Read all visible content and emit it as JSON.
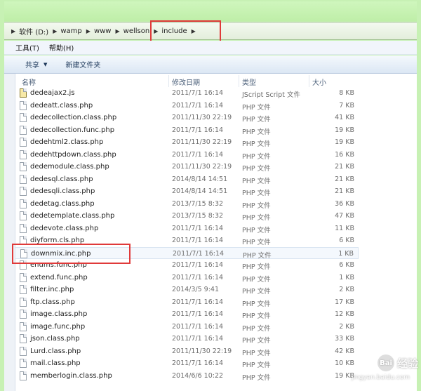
{
  "address": {
    "crumbs": [
      "软件 (D:)",
      "wamp",
      "www",
      "wellson",
      "include"
    ]
  },
  "menu": {
    "tools": "工具(T)",
    "help": "帮助(H)"
  },
  "toolbar": {
    "share": "共享",
    "new_folder": "新建文件夹"
  },
  "columns": {
    "name": "名称",
    "date": "修改日期",
    "type": "类型",
    "size": "大小"
  },
  "files": [
    {
      "name": "dedeajax2.js",
      "date": "2011/7/1 16:14",
      "type": "JScript Script 文件",
      "size": "8 KB"
    },
    {
      "name": "dedeatt.class.php",
      "date": "2011/7/1 16:14",
      "type": "PHP 文件",
      "size": "7 KB"
    },
    {
      "name": "dedecollection.class.php",
      "date": "2011/11/30 22:19",
      "type": "PHP 文件",
      "size": "41 KB"
    },
    {
      "name": "dedecollection.func.php",
      "date": "2011/7/1 16:14",
      "type": "PHP 文件",
      "size": "19 KB"
    },
    {
      "name": "dedehtml2.class.php",
      "date": "2011/11/30 22:19",
      "type": "PHP 文件",
      "size": "19 KB"
    },
    {
      "name": "dedehttpdown.class.php",
      "date": "2011/7/1 16:14",
      "type": "PHP 文件",
      "size": "16 KB"
    },
    {
      "name": "dedemodule.class.php",
      "date": "2011/11/30 22:19",
      "type": "PHP 文件",
      "size": "21 KB"
    },
    {
      "name": "dedesql.class.php",
      "date": "2014/8/14 14:51",
      "type": "PHP 文件",
      "size": "21 KB"
    },
    {
      "name": "dedesqli.class.php",
      "date": "2014/8/14 14:51",
      "type": "PHP 文件",
      "size": "21 KB"
    },
    {
      "name": "dedetag.class.php",
      "date": "2013/7/15 8:32",
      "type": "PHP 文件",
      "size": "36 KB"
    },
    {
      "name": "dedetemplate.class.php",
      "date": "2013/7/15 8:32",
      "type": "PHP 文件",
      "size": "47 KB"
    },
    {
      "name": "dedevote.class.php",
      "date": "2011/7/1 16:14",
      "type": "PHP 文件",
      "size": "11 KB"
    },
    {
      "name": "diyform.cls.php",
      "date": "2011/7/1 16:14",
      "type": "PHP 文件",
      "size": "6 KB"
    },
    {
      "name": "downmix.inc.php",
      "date": "2011/7/1 16:14",
      "type": "PHP 文件",
      "size": "1 KB"
    },
    {
      "name": "enums.func.php",
      "date": "2011/7/1 16:14",
      "type": "PHP 文件",
      "size": "6 KB"
    },
    {
      "name": "extend.func.php",
      "date": "2011/7/1 16:14",
      "type": "PHP 文件",
      "size": "1 KB"
    },
    {
      "name": "filter.inc.php",
      "date": "2014/3/5 9:41",
      "type": "PHP 文件",
      "size": "2 KB"
    },
    {
      "name": "ftp.class.php",
      "date": "2011/7/1 16:14",
      "type": "PHP 文件",
      "size": "17 KB"
    },
    {
      "name": "image.class.php",
      "date": "2011/7/1 16:14",
      "type": "PHP 文件",
      "size": "12 KB"
    },
    {
      "name": "image.func.php",
      "date": "2011/7/1 16:14",
      "type": "PHP 文件",
      "size": "2 KB"
    },
    {
      "name": "json.class.php",
      "date": "2011/7/1 16:14",
      "type": "PHP 文件",
      "size": "33 KB"
    },
    {
      "name": "Lurd.class.php",
      "date": "2011/11/30 22:19",
      "type": "PHP 文件",
      "size": "42 KB"
    },
    {
      "name": "mail.class.php",
      "date": "2011/7/1 16:14",
      "type": "PHP 文件",
      "size": "10 KB"
    },
    {
      "name": "memberlogin.class.php",
      "date": "2014/6/6 10:22",
      "type": "PHP 文件",
      "size": "19 KB"
    }
  ],
  "selected_index": 13,
  "watermark": {
    "badge": "Bai",
    "text": "经验",
    "url": "jingyan.baidu.com"
  }
}
